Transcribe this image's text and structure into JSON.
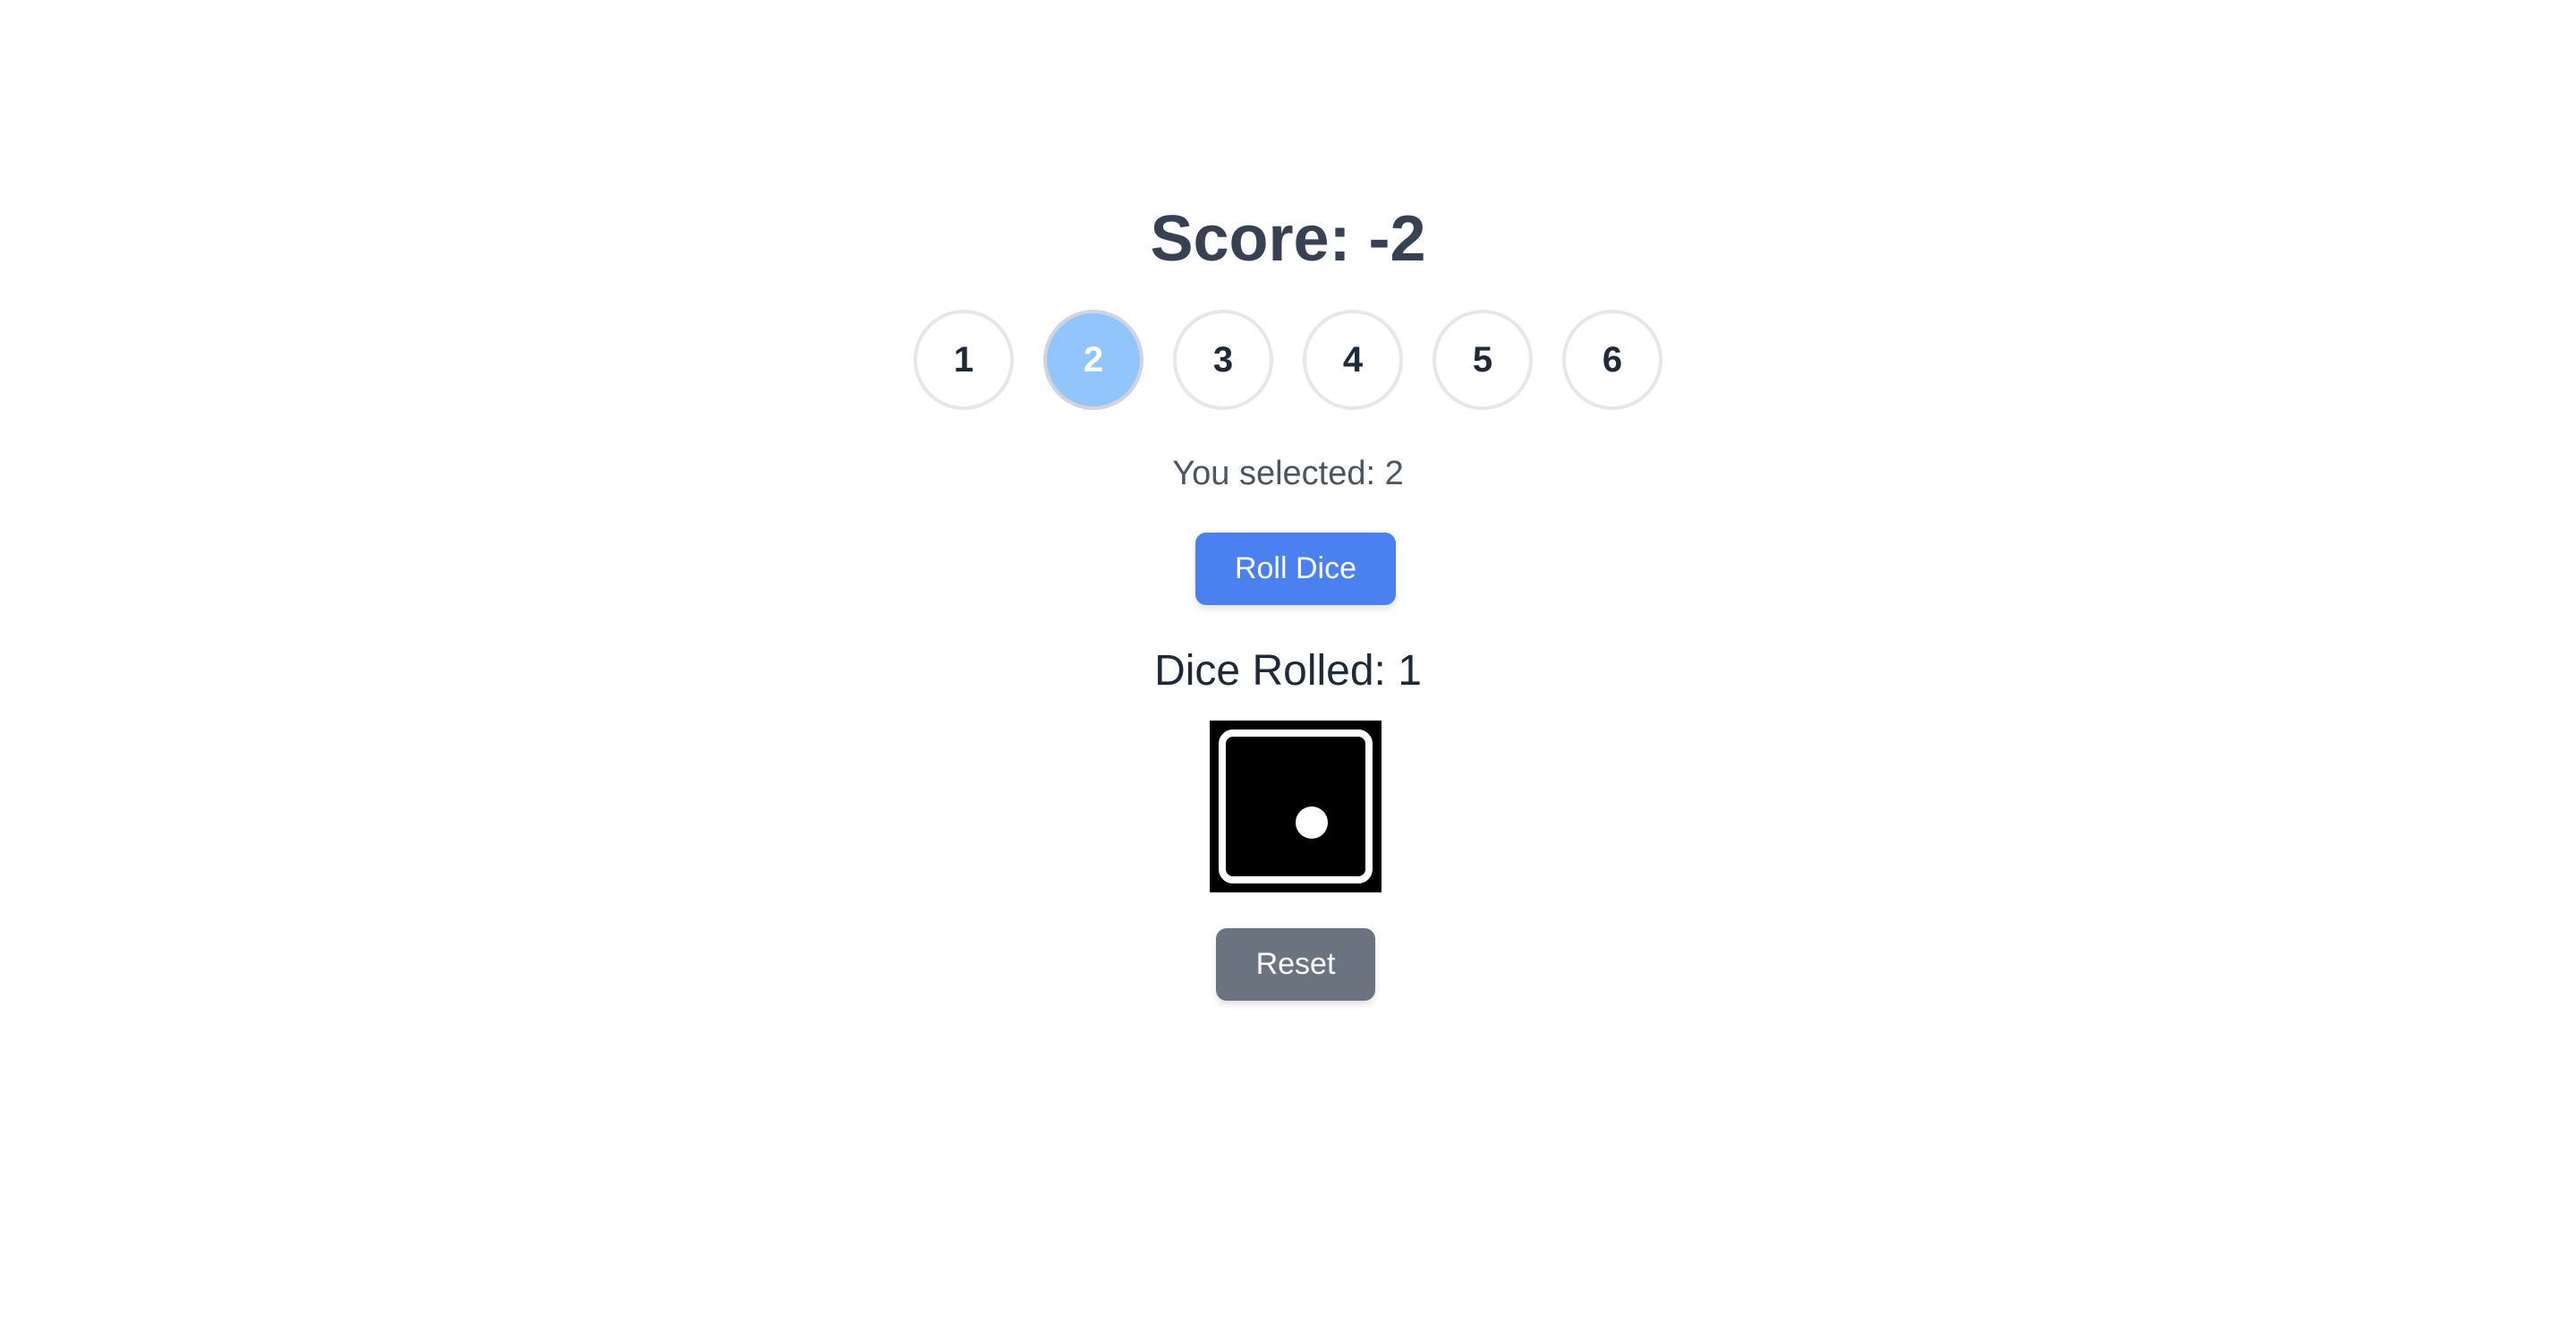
{
  "score": {
    "label": "Score: -2"
  },
  "numbers": {
    "options": [
      "1",
      "2",
      "3",
      "4",
      "5",
      "6"
    ],
    "selected": "2"
  },
  "selection": {
    "text": "You selected: 2"
  },
  "actions": {
    "roll_label": "Roll Dice",
    "reset_label": "Reset"
  },
  "dice": {
    "rolled_text": "Dice Rolled: 1",
    "face_value": 1,
    "icon": "dice-one-icon"
  },
  "colors": {
    "selected_circle": "#93c5fd",
    "roll_button": "#4a80f0",
    "reset_button": "#6b7280",
    "title_text": "#374151"
  }
}
